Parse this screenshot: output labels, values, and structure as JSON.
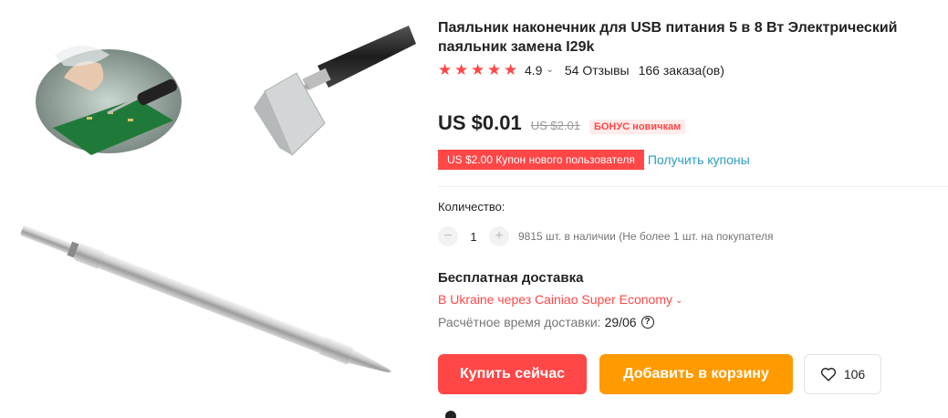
{
  "product": {
    "title": "Паяльник наконечник для USB питания 5 в 8 Вт Электрический паяльник заменa I29k"
  },
  "rating": {
    "stars": 5,
    "value": "4.9",
    "reviews": "54 Отзывы",
    "orders": "166 заказа(ов)"
  },
  "price": {
    "current": "US $0.01",
    "original": "US $2.01",
    "badge": "БОНУС новичкам"
  },
  "coupon": {
    "tag": "US $2.00 Купон нового пользователя",
    "link": "Получить купоны"
  },
  "quantity": {
    "label": "Количество:",
    "minus": "−",
    "value": "1",
    "plus": "+",
    "stock": "9815 шт. в наличии (Не более 1 шт. на покупателя"
  },
  "shipping": {
    "title": "Бесплатная доставка",
    "route": "В Ukraine через Cainiao Super Economy",
    "time_label": "Расчётное время доставки:",
    "date": "29/06",
    "help": "?"
  },
  "actions": {
    "buy": "Купить сейчас",
    "cart": "Добавить в корзину",
    "wishlist_count": "106"
  },
  "colors": {
    "accent_red": "#ff4747",
    "accent_orange": "#ff9a00",
    "link_blue": "#2e9cc3"
  },
  "icons": {
    "star": "star-icon",
    "chevron": "chevron-down-icon",
    "heart": "heart-icon",
    "help": "question-circle-icon"
  }
}
